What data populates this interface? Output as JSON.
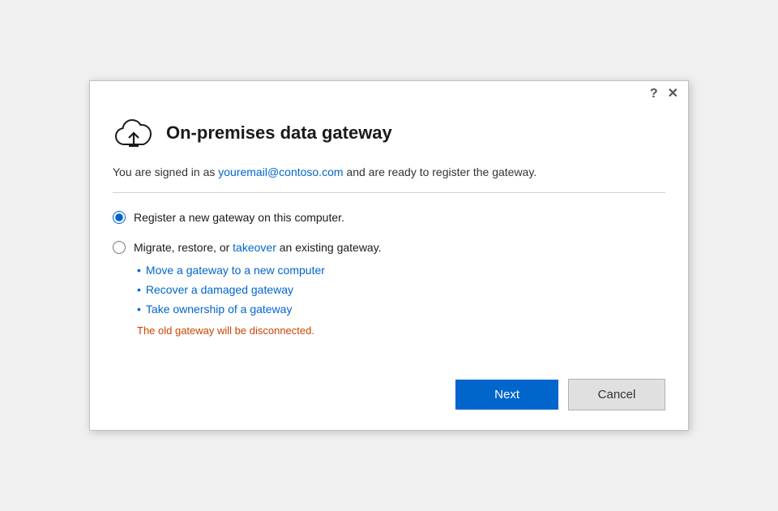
{
  "titlebar": {
    "help_icon": "?",
    "close_icon": "✕"
  },
  "header": {
    "title": "On-premises data gateway",
    "cloud_icon_alt": "cloud-upload-icon"
  },
  "body": {
    "signed_in_prefix": "You are signed in as ",
    "email": "youremail@contoso.com",
    "signed_in_suffix": " and are ready to register the gateway.",
    "options": [
      {
        "id": "opt-register",
        "label": "Register a new gateway on this computer.",
        "checked": true
      },
      {
        "id": "opt-migrate",
        "label_prefix": "Migrate, restore, or ",
        "label_link": "takeover",
        "label_suffix": " an existing gateway.",
        "checked": false,
        "sub_items": [
          "Move a gateway to a new computer",
          "Recover a damaged gateway",
          "Take ownership of a gateway"
        ],
        "warning": "The old gateway will be disconnected."
      }
    ]
  },
  "footer": {
    "next_label": "Next",
    "cancel_label": "Cancel"
  }
}
